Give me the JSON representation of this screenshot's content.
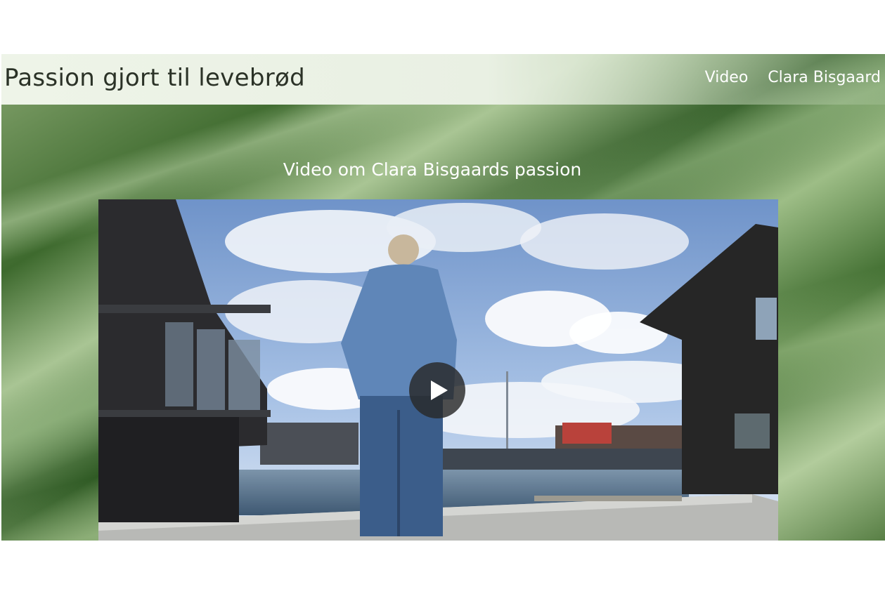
{
  "header": {
    "site_title": "Passion gjort til levebrød",
    "nav": [
      {
        "label": "Video"
      },
      {
        "label": "Clara Bisgaard"
      }
    ]
  },
  "main": {
    "section_title": "Video om Clara Bisgaards passion",
    "video": {
      "play_icon": "play-icon"
    }
  },
  "colors": {
    "background_accent": "#3e6a2e",
    "header_text": "#2b3227",
    "nav_text": "#ffffff"
  }
}
